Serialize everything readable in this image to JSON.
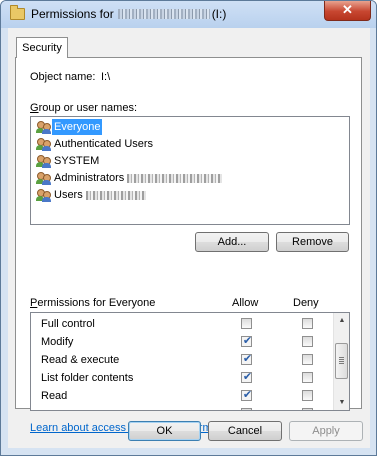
{
  "window": {
    "title_prefix": "Permissions for",
    "title_suffix": "(I:)",
    "close_glyph": "✕",
    "icon": "folder-icon"
  },
  "tabs": [
    {
      "label": "Security"
    }
  ],
  "object": {
    "label": "Object name:",
    "value": "I:\\"
  },
  "group": {
    "label_prefix": "G",
    "label_rest": "roup or user names:",
    "users": [
      {
        "name": "Everyone",
        "selected": true,
        "icon": "users-icon"
      },
      {
        "name": "Authenticated Users",
        "selected": false,
        "icon": "users-icon"
      },
      {
        "name": "SYSTEM",
        "selected": false,
        "icon": "users-icon"
      },
      {
        "name": "Administrators",
        "selected": false,
        "icon": "users-icon"
      },
      {
        "name": "Users",
        "selected": false,
        "icon": "users-icon"
      }
    ]
  },
  "buttons": {
    "add": "Add...",
    "remove": "Remove",
    "ok": "OK",
    "cancel": "Cancel",
    "apply": "Apply"
  },
  "permissions": {
    "label_prefix": "P",
    "label_rest": "ermissions for Everyone",
    "allow_header": "Allow",
    "deny_header": "Deny",
    "rows": [
      {
        "name": "Full control",
        "allow": false,
        "deny": false
      },
      {
        "name": "Modify",
        "allow": true,
        "deny": false
      },
      {
        "name": "Read & execute",
        "allow": true,
        "deny": false
      },
      {
        "name": "List folder contents",
        "allow": true,
        "deny": false
      },
      {
        "name": "Read",
        "allow": true,
        "deny": false
      }
    ],
    "scroll_up_glyph": "▲",
    "scroll_down_glyph": "▼"
  },
  "link": {
    "text": "Learn about access control and permissions"
  },
  "colors": {
    "selection": "#3399ff",
    "link": "#0066cc",
    "close": "#c74630"
  }
}
